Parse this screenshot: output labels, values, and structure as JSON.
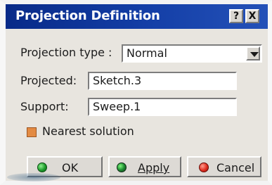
{
  "window": {
    "title": "Projection Definition",
    "help_label": "?",
    "close_label": "X"
  },
  "form": {
    "projection_type_label": "Projection type :",
    "projection_type_value": "Normal",
    "projected_label": "Projected:",
    "projected_value": "Sketch.3",
    "support_label": "Support:",
    "support_value": "Sweep.1",
    "nearest_solution_label": "Nearest solution",
    "nearest_solution_checked": true
  },
  "buttons": {
    "ok": "OK",
    "apply": "Apply",
    "cancel": "Cancel"
  },
  "icons": {
    "ok": "green-dot-icon",
    "apply": "green-dark-dot-icon",
    "cancel": "red-dot-icon",
    "dropdown": "chevron-down-icon"
  },
  "colors": {
    "titlebar": "#143fa7",
    "checkbox": "#e38b43",
    "ok_icon": "#1d9a2b",
    "cancel_icon": "#df2d1f"
  }
}
